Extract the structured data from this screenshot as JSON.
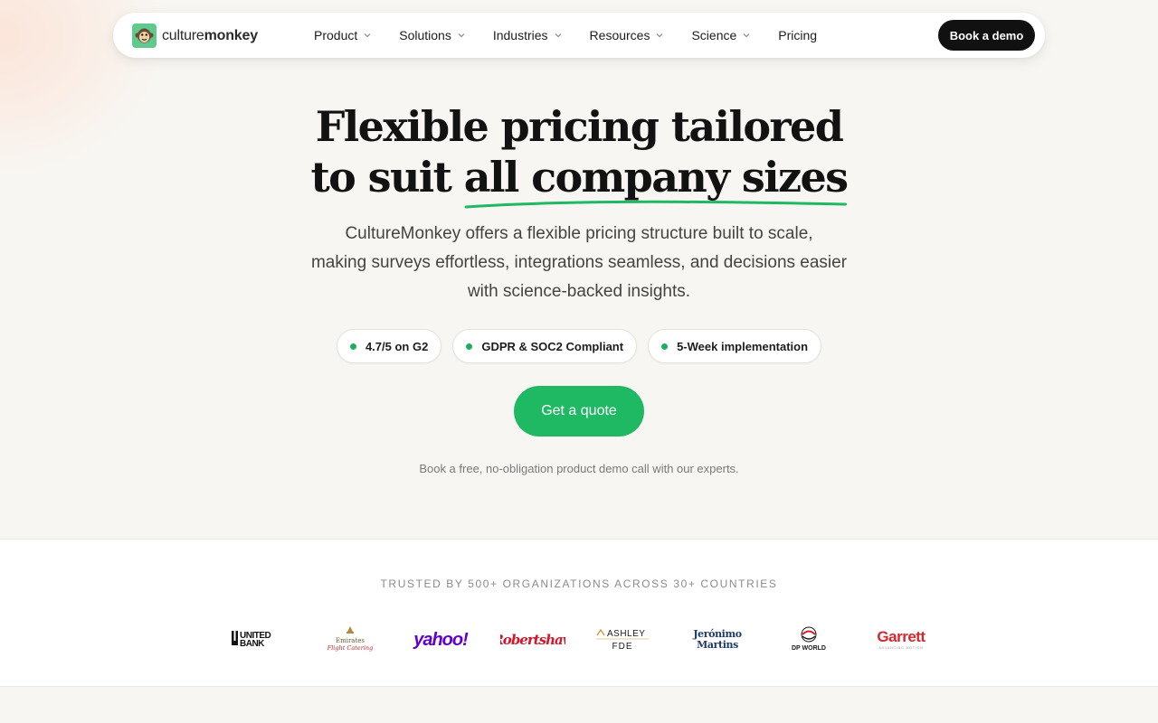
{
  "nav": {
    "logo": {
      "name_light": "culture",
      "name_bold": "monkey",
      "icon": "monkey-face-icon"
    },
    "items": [
      {
        "label": "Product",
        "has_dropdown": true
      },
      {
        "label": "Solutions",
        "has_dropdown": true
      },
      {
        "label": "Industries",
        "has_dropdown": true
      },
      {
        "label": "Resources",
        "has_dropdown": true
      },
      {
        "label": "Science",
        "has_dropdown": true
      },
      {
        "label": "Pricing",
        "has_dropdown": false
      }
    ],
    "cta_label": "Book a demo"
  },
  "hero": {
    "headline_line1": "Flexible pricing tailored",
    "headline_line2_plain": "to suit ",
    "headline_line2_underlined": "all company sizes",
    "subtitle_line1": "CultureMonkey offers a flexible pricing structure built to scale,",
    "subtitle_line2": "making surveys effortless, integrations seamless, and decisions easier",
    "subtitle_line3": "with science-backed insights.",
    "badges": [
      {
        "label": "4.7/5 on G2"
      },
      {
        "label": "GDPR & SOC2 Compliant"
      },
      {
        "label": "5-Week implementation"
      }
    ],
    "cta_label": "Get a quote",
    "note": "Book a free, no-obligation product demo call with our experts."
  },
  "trusted": {
    "title": "TRUSTED BY 500+ ORGANIZATIONS ACROSS 30+ COUNTRIES",
    "logos": [
      {
        "name": "UNITED BANK",
        "line1": "UNITED",
        "line2": "BANK"
      },
      {
        "name": "Emirates Flight Catering",
        "line1": "Emirates",
        "line2": "Flight Catering"
      },
      {
        "name": "yahoo!",
        "line1": "yahoo!"
      },
      {
        "name": "Robertshaw",
        "line1": "Robertshaw"
      },
      {
        "name": "ASHLEY FDE",
        "line1": "ASHLEY",
        "line2": "FDE"
      },
      {
        "name": "Jerónimo Martins",
        "line1": "Jerónimo",
        "line2": "Martins"
      },
      {
        "name": "DP WORLD",
        "line1": "DP WORLD"
      },
      {
        "name": "Garrett",
        "line1": "Garrett",
        "line2": "ADVANCING MOTION"
      }
    ]
  },
  "colors": {
    "accent_green": "#1fb863",
    "dark_button": "#111111",
    "page_background": "#f8f6f2"
  }
}
